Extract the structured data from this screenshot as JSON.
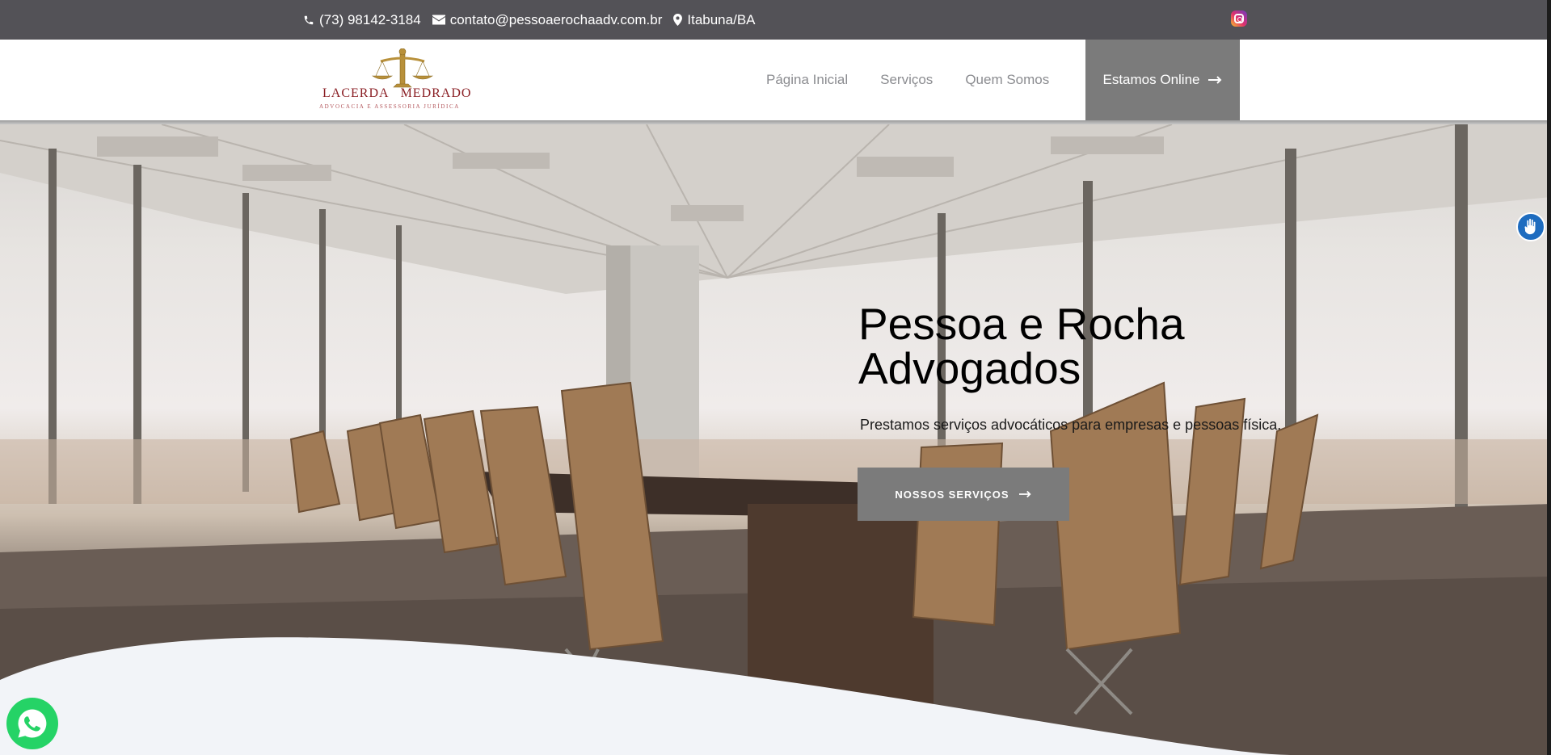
{
  "topbar": {
    "phone": "(73) 98142-3184",
    "email": "contato@pessoaerochaadv.com.br",
    "location": "Itabuna/BA",
    "social_icon": "instagram-icon"
  },
  "logo": {
    "left_word": "LACERDA",
    "right_word": "MEDRADO",
    "tagline": "Advocacia e Assessoria Jurídica"
  },
  "nav": {
    "items": [
      {
        "label": "Página Inicial"
      },
      {
        "label": "Serviços"
      },
      {
        "label": "Quem Somos"
      }
    ],
    "cta": "Estamos Online"
  },
  "hero": {
    "title_line1": "Pessoa e Rocha",
    "title_line2": "Advogados",
    "subtitle": "Prestamos serviços advocáticos para empresas e pessoas física.",
    "button": "NOSSOS SERVIÇOS"
  },
  "floating": {
    "accessibility_icon": "hand-sign-icon",
    "whatsapp_icon": "whatsapp-icon"
  },
  "colors": {
    "topbar": "#535257",
    "accent_gray": "#7b7b7b",
    "nav_text": "#8b8c90",
    "whatsapp": "#25d366",
    "accessibility": "#1e6cbf"
  }
}
